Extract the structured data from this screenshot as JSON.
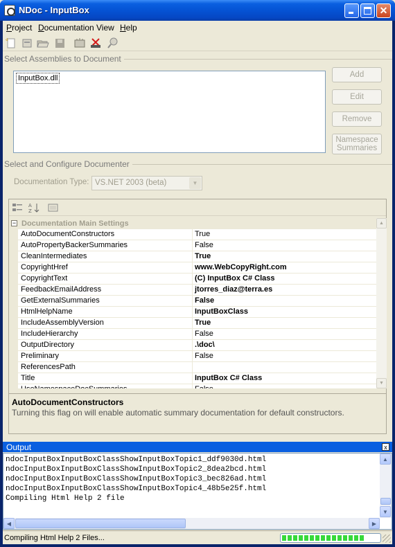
{
  "window": {
    "title": "NDoc - InputBox"
  },
  "menu": [
    {
      "label": "Project",
      "underline": "P",
      "rest": "roject"
    },
    {
      "label": "Documentation",
      "underline": "D",
      "rest": "ocumentation"
    },
    {
      "label": "View",
      "underline": "",
      "rest": "View"
    },
    {
      "label": "Help",
      "underline": "H",
      "rest": "elp"
    }
  ],
  "toolbar": {
    "icons": [
      "new-project-icon",
      "new-from-assembly-icon",
      "open-icon",
      "save-icon",
      "build-icon",
      "cancel-build-icon",
      "view-output-icon"
    ]
  },
  "assemblies": {
    "group_label": "Select Assemblies to Document",
    "items": [
      "InputBox.dll"
    ],
    "buttons": {
      "add": "Add",
      "edit": "Edit",
      "remove": "Remove",
      "namespace_line1": "Namespace",
      "namespace_line2": "Summaries"
    }
  },
  "documenter": {
    "group_label": "Select and Configure Documenter",
    "type_label": "Documentation Type:",
    "type_value": "VS.NET 2003 (beta)"
  },
  "property_grid": {
    "category": "Documentation Main Settings",
    "rows": [
      {
        "name": "AutoDocumentConstructors",
        "value": "True",
        "bold": false
      },
      {
        "name": "AutoPropertyBackerSummaries",
        "value": "False",
        "bold": false
      },
      {
        "name": "CleanIntermediates",
        "value": "True",
        "bold": true
      },
      {
        "name": "CopyrightHref",
        "value": "www.WebCopyRight.com",
        "bold": true
      },
      {
        "name": "CopyrightText",
        "value": "(C) InputBox C# Class",
        "bold": true
      },
      {
        "name": "FeedbackEmailAddress",
        "value": "jtorres_diaz@terra.es",
        "bold": true
      },
      {
        "name": "GetExternalSummaries",
        "value": "False",
        "bold": true
      },
      {
        "name": "HtmlHelpName",
        "value": "InputBoxClass",
        "bold": true
      },
      {
        "name": "IncludeAssemblyVersion",
        "value": "True",
        "bold": true
      },
      {
        "name": "IncludeHierarchy",
        "value": "False",
        "bold": false
      },
      {
        "name": "OutputDirectory",
        "value": ".\\doc\\",
        "bold": true
      },
      {
        "name": "Preliminary",
        "value": "False",
        "bold": false
      },
      {
        "name": "ReferencesPath",
        "value": "",
        "bold": false
      },
      {
        "name": "Title",
        "value": "InputBox C# Class",
        "bold": true
      },
      {
        "name": "UseNamespaceDocSummaries",
        "value": "False",
        "bold": false
      }
    ],
    "help_title": "AutoDocumentConstructors",
    "help_text": "Turning this flag on will enable automatic summary documentation for default constructors."
  },
  "output": {
    "title": "Output",
    "lines": [
      "ndocInputBoxInputBoxClassShowInputBoxTopic1_ddf9030d.html",
      "ndocInputBoxInputBoxClassShowInputBoxTopic2_8dea2bcd.html",
      "ndocInputBoxInputBoxClassShowInputBoxTopic3_bec826ad.html",
      "ndocInputBoxInputBoxClassShowInputBoxTopic4_48b5e25f.html",
      "Compiling Html Help 2 file"
    ]
  },
  "status": {
    "text": "Compiling Html Help 2 Files...",
    "progress_fraction": 0.85
  },
  "colors": {
    "titlebar": "#0553d4",
    "progress": "#37d93b",
    "output_header": "#0a5fe0"
  }
}
